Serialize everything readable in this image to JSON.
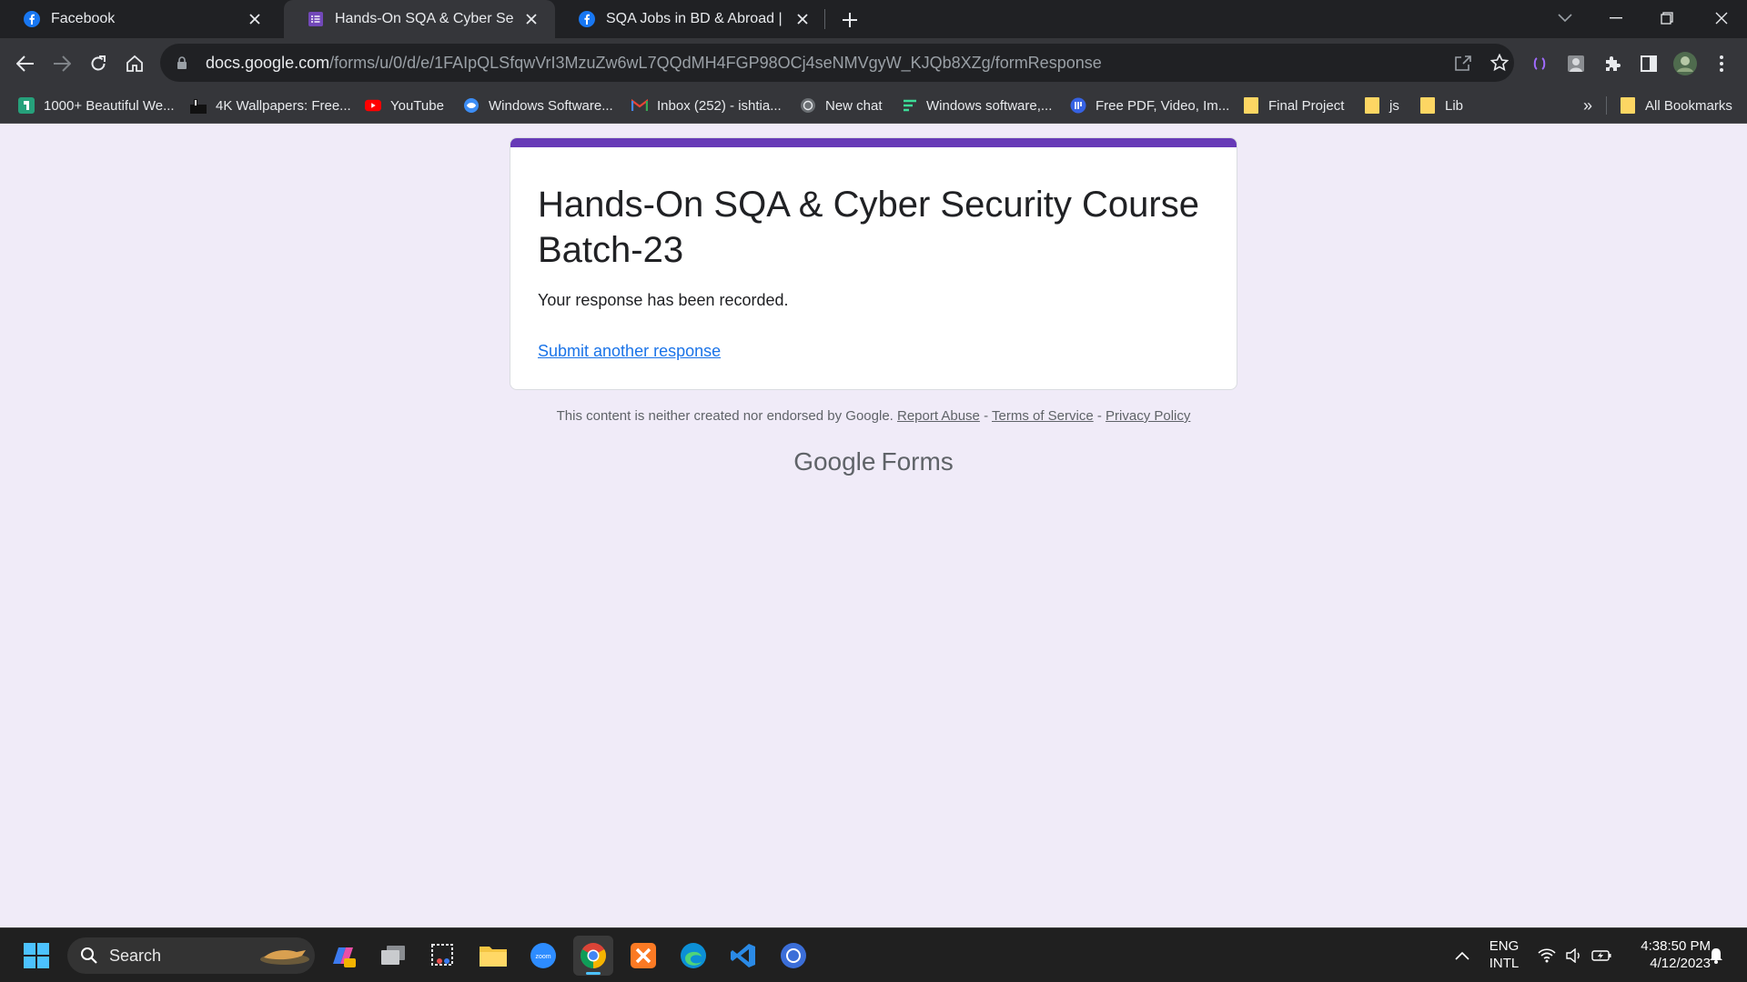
{
  "browser": {
    "tabs": [
      {
        "title": "Facebook",
        "icon": "facebook-icon",
        "active": false
      },
      {
        "title": "Hands-On SQA & Cyber Security",
        "icon": "google-forms-icon",
        "active": true
      },
      {
        "title": "SQA Jobs in BD & Abroad | Face",
        "icon": "facebook-icon",
        "active": false
      }
    ],
    "address": {
      "host": "docs.google.com",
      "path": "/forms/u/0/d/e/1FAIpQLSfqwVrI3MzuZw6wL7QQdMH4FGP98OCj4seNMVgyW_KJQb8XZg/formResponse"
    },
    "bookmarks": [
      {
        "label": "1000+ Beautiful We...",
        "icon": "site-icon"
      },
      {
        "label": "4K Wallpapers: Free...",
        "icon": "site-icon"
      },
      {
        "label": "YouTube",
        "icon": "youtube-icon"
      },
      {
        "label": "Windows Software...",
        "icon": "site-icon"
      },
      {
        "label": "Inbox (252) - ishtia...",
        "icon": "gmail-icon"
      },
      {
        "label": "New chat",
        "icon": "chat-icon"
      },
      {
        "label": "Windows software,...",
        "icon": "site-icon"
      },
      {
        "label": "Free PDF, Video, Im...",
        "icon": "site-icon"
      },
      {
        "label": "Final Project",
        "icon": "folder-icon"
      },
      {
        "label": "js",
        "icon": "folder-icon"
      },
      {
        "label": "Lib",
        "icon": "folder-icon"
      }
    ],
    "bookmarks_overflow": "»",
    "all_bookmarks": "All Bookmarks"
  },
  "form": {
    "title": "Hands-On SQA & Cyber Security Course Batch-23",
    "message": "Your response has been recorded.",
    "submit_another": "Submit another response",
    "accent_color": "#673ab7"
  },
  "footer": {
    "disclaimer": "This content is neither created nor endorsed by Google.",
    "report_abuse": "Report Abuse",
    "terms": "Terms of Service",
    "privacy": "Privacy Policy",
    "sep": "-",
    "brand_google": "Google",
    "brand_forms": "Forms"
  },
  "taskbar": {
    "search_label": "Search",
    "lang_line1": "ENG",
    "lang_line2": "INTL",
    "time": "4:38:50 PM",
    "date": "4/12/2023"
  }
}
